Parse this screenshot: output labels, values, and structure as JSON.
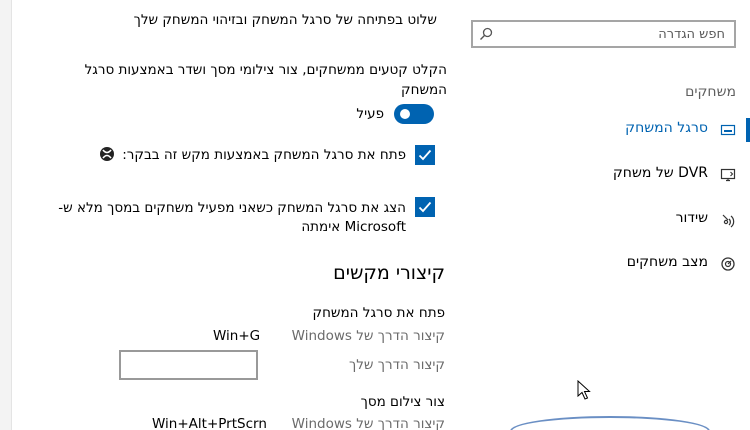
{
  "search": {
    "placeholder": "חפש הגדרה"
  },
  "nav": {
    "section": "משחקים",
    "items": [
      {
        "label": "סרגל המשחק",
        "icon": "game-bar-icon"
      },
      {
        "label": "DVR של משחק",
        "icon": "game-dvr-icon"
      },
      {
        "label": "שידור",
        "icon": "broadcasting-icon"
      },
      {
        "label": "מצב משחקים",
        "icon": "game-mode-icon"
      }
    ]
  },
  "content": {
    "top_text": "שלוט בפתיחה של סרגל המשחק ובזיהוי המשחק שלך",
    "record_desc_line1": "הקלט קטעים ממשחקים, צור צילומי מסך ושדר באמצעות סרגל",
    "record_desc_line2": "המשחק",
    "toggle_state": "פעיל",
    "checkbox1_label": "פתח את סרגל המשחק באמצעות מקש זה בבקר:",
    "checkbox2_line1": "הצג את סרגל המשחק כשאני מפעיל משחקים במסך מלא ש-",
    "checkbox2_line2": "Microsoft אימתה",
    "shortcuts_title": "קיצורי מקשים",
    "open_bar_heading": "פתח את סרגל המשחק",
    "windows_shortcut_label": "קיצור הדרך של Windows",
    "open_bar_windows_value": "Win+G",
    "your_shortcut_label": "קיצור הדרך שלך",
    "screenshot_heading": "צור צילום מסך",
    "screenshot_windows_value": "Win+Alt+PrtScrn"
  },
  "colors": {
    "accent": "#0063b1"
  }
}
